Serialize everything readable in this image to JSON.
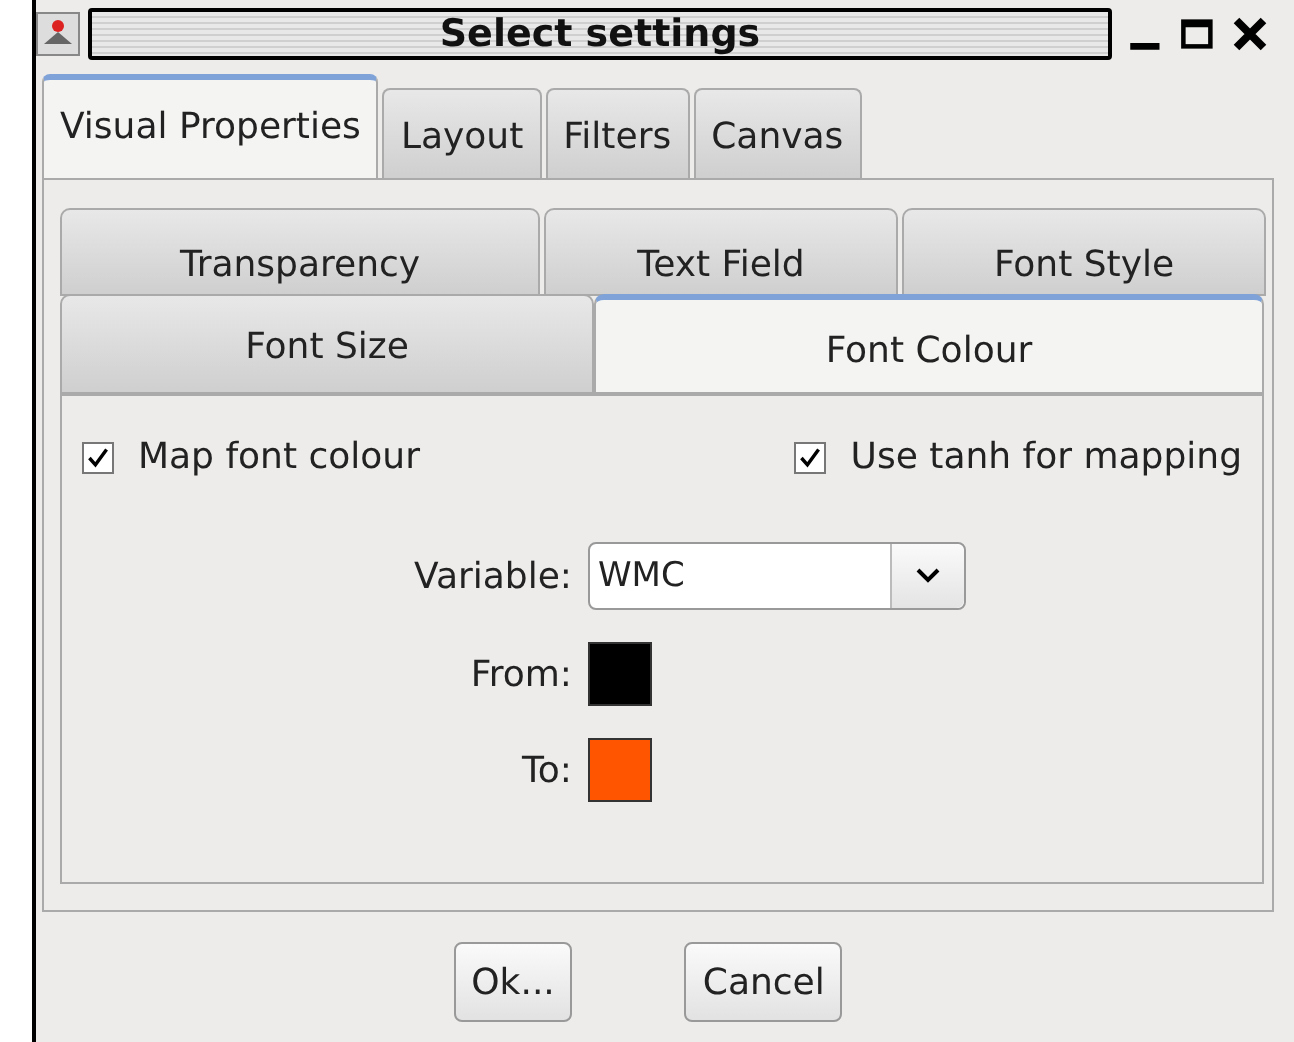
{
  "window": {
    "title": "Select settings"
  },
  "tabs": [
    {
      "label": "Visual Properties",
      "selected": true
    },
    {
      "label": "Layout",
      "selected": false
    },
    {
      "label": "Filters",
      "selected": false
    },
    {
      "label": "Canvas",
      "selected": false
    }
  ],
  "inner_tabs": {
    "rows": [
      [
        {
          "label": "Transparency",
          "selected": false
        },
        {
          "label": "Text Field",
          "selected": false
        },
        {
          "label": "Font Style",
          "selected": false
        }
      ],
      [
        {
          "label": "Font Size",
          "selected": false
        },
        {
          "label": "Font Colour",
          "selected": true
        }
      ]
    ]
  },
  "options": [
    {
      "label": "Map font colour",
      "checked": true
    },
    {
      "label": "Use tanh for mapping",
      "checked": true
    }
  ],
  "variable": {
    "label": "Variable:",
    "value": "WMC"
  },
  "colours": [
    {
      "label": "From:",
      "color": "#000000"
    },
    {
      "label": "To:",
      "color": "#ff5500"
    }
  ],
  "buttons": [
    "Ok...",
    "Cancel"
  ]
}
